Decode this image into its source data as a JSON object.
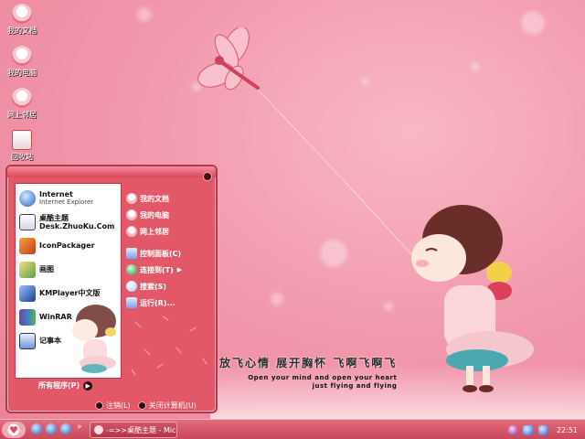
{
  "desktop": {
    "icons": [
      {
        "label": "我的文档",
        "icon": "documents-icon"
      },
      {
        "label": "我的电脑",
        "icon": "computer-icon"
      },
      {
        "label": "网上邻居",
        "icon": "network-icon"
      },
      {
        "label": "回收站",
        "icon": "recycle-bin-icon"
      }
    ],
    "slogan": {
      "cn": "放飞心情 展开胸怀 飞啊飞啊飞",
      "en1": "Open your mind and open your heart",
      "en2": "just flying and flying"
    }
  },
  "start_menu": {
    "left_items": [
      {
        "title": "Internet",
        "subtitle": "Internet Explorer",
        "icon": "internet-explorer-icon"
      },
      {
        "title": "桌酷主题",
        "subtitle": "Desk.ZhuoKu.Com",
        "icon": "zhuoku-icon"
      },
      {
        "title": "IconPackager",
        "subtitle": "",
        "icon": "iconpackager-icon"
      },
      {
        "title": "画图",
        "subtitle": "",
        "icon": "paint-icon"
      },
      {
        "title": "KMPlayer中文版",
        "subtitle": "",
        "icon": "kmplayer-icon"
      },
      {
        "title": "WinRAR",
        "subtitle": "",
        "icon": "winrar-icon"
      },
      {
        "title": "记事本",
        "subtitle": "",
        "icon": "notepad-icon"
      }
    ],
    "all_programs": "所有程序(P)",
    "right_items": [
      {
        "label": "我的文档",
        "icon": "documents-icon"
      },
      {
        "label": "我的电脑",
        "icon": "computer-icon"
      },
      {
        "label": "网上邻居",
        "icon": "network-icon"
      }
    ],
    "right_items_2": [
      {
        "label": "控制面板(C)",
        "icon": "control-panel-icon"
      },
      {
        "label": "连接到(T)",
        "icon": "connect-icon",
        "submenu": "▶"
      },
      {
        "label": "搜索(S)",
        "icon": "search-icon"
      },
      {
        "label": "运行(R)...",
        "icon": "run-icon"
      }
    ],
    "logoff": "注销(L)",
    "shutdown": "关闭计算机(U)"
  },
  "taskbar": {
    "start_icon": "♥",
    "quick_more": "»",
    "task_label": "-=>>桌酷主题 - Mic...",
    "clock": "22:51"
  },
  "colors": {
    "accent": "#e35869",
    "border": "#b8384b",
    "taskbar": "#c9475a"
  }
}
